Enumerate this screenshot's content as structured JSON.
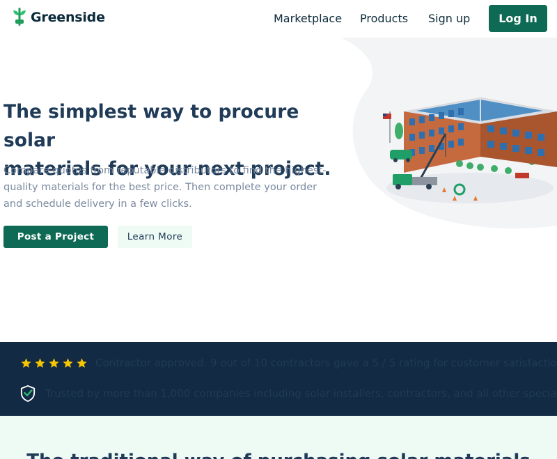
{
  "brand": {
    "name": "Greenside",
    "color": "#0f6a55",
    "icon": "plug-leaf-icon"
  },
  "nav": {
    "links": [
      "Marketplace",
      "Products",
      "Sign up"
    ],
    "login_label": "Log In"
  },
  "hero": {
    "title_line1": "The simplest way to procure solar",
    "title_line2": "materials for your next project.",
    "subtitle": "Compare quotes from reputable distributors to find the highest-quality materials for the best price. Then complete your order and schedule delivery in a few clicks.",
    "primary_cta": "Post a Project",
    "secondary_cta": "Learn More",
    "illustration": "solar-installation-building-illustration"
  },
  "trust": {
    "rating_text": "Contractor approved. 9 out of 10 contractors gave a 5 / 5 rating for customer satisfaction",
    "stars": 5,
    "star_color": "#f7c600",
    "trusted_text": "Trusted by more than 1,000 companies including solar installers, contractors, and all other specialties",
    "shield_icon": "shield-check-icon",
    "background": "#122a44"
  },
  "next_section": {
    "title": "The traditional way of purchasing solar materials"
  }
}
